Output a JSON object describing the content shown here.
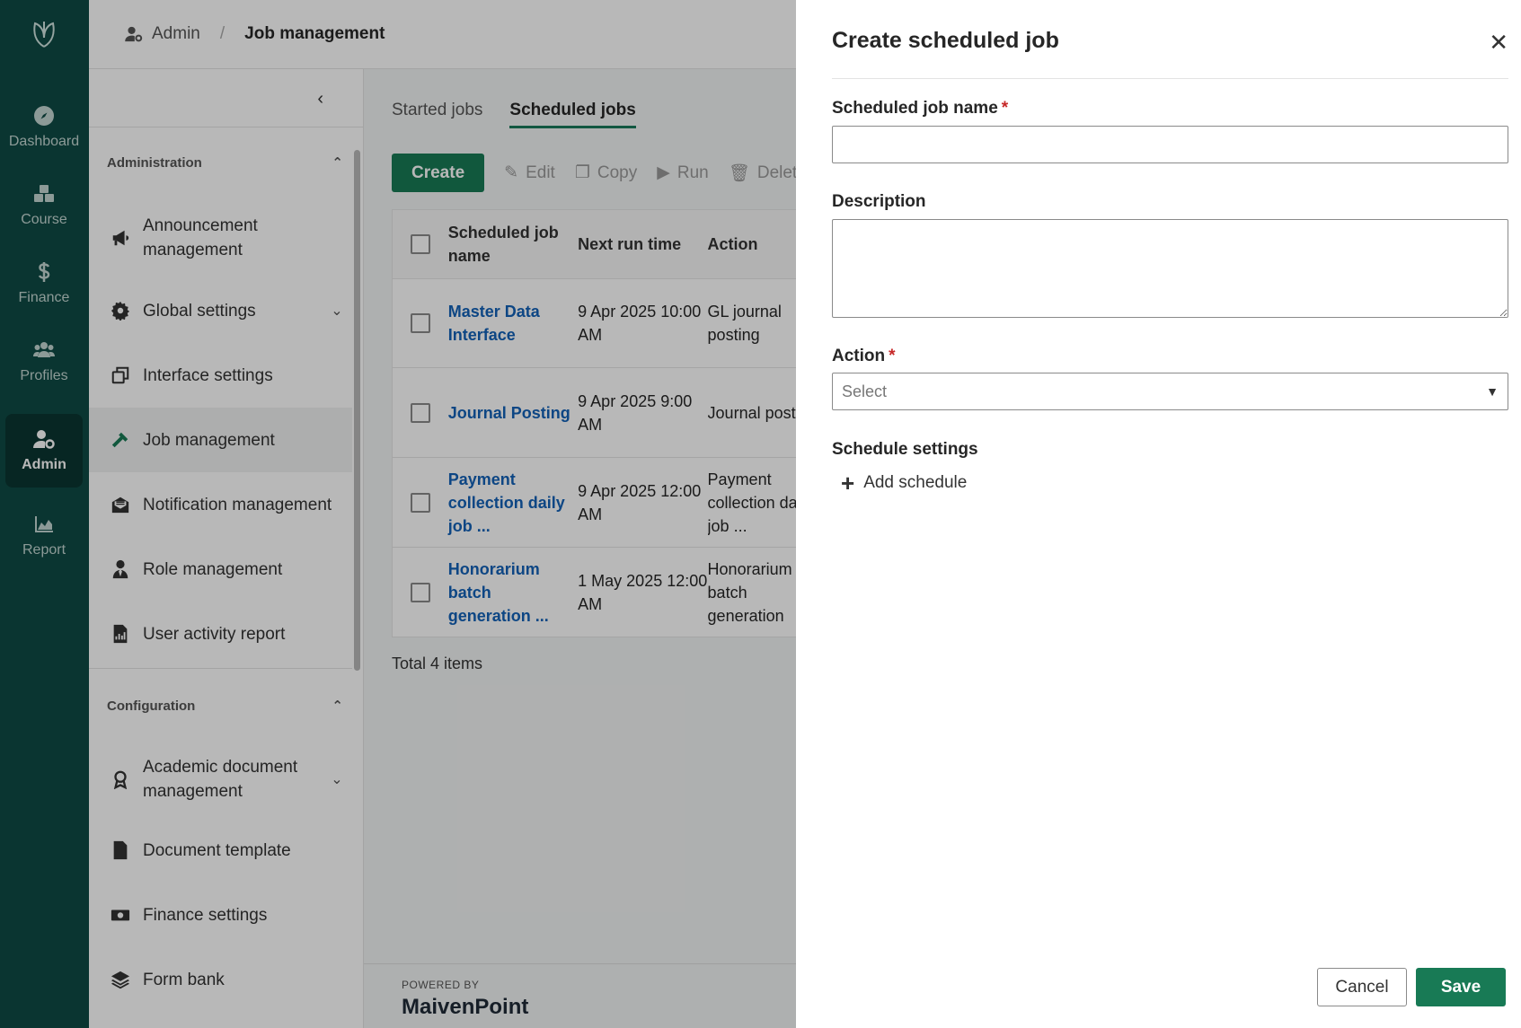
{
  "rail": {
    "items": [
      {
        "label": "Dashboard",
        "icon": "compass-icon"
      },
      {
        "label": "Course",
        "icon": "cubes-icon"
      },
      {
        "label": "Finance",
        "icon": "dollar-icon"
      },
      {
        "label": "Profiles",
        "icon": "users-icon"
      },
      {
        "label": "Admin",
        "icon": "user-gear-icon",
        "active": true
      },
      {
        "label": "Report",
        "icon": "area-chart-icon"
      }
    ]
  },
  "breadcrumb": {
    "parent": "Admin",
    "separator": "/",
    "current": "Job management"
  },
  "sidebar": {
    "sections": [
      {
        "title": "Administration",
        "items": [
          {
            "label": "Announcement management",
            "icon": "megaphone-icon"
          },
          {
            "label": "Global settings",
            "icon": "gear-icon",
            "expandable": true
          },
          {
            "label": "Interface settings",
            "icon": "windows-icon"
          },
          {
            "label": "Job management",
            "icon": "hammer-icon",
            "active": true
          },
          {
            "label": "Notification management",
            "icon": "envelope-icon"
          },
          {
            "label": "Role management",
            "icon": "user-tie-icon"
          },
          {
            "label": "User activity report",
            "icon": "file-chart-icon"
          }
        ]
      },
      {
        "title": "Configuration",
        "items": [
          {
            "label": "Academic document management",
            "icon": "award-icon",
            "expandable": true
          },
          {
            "label": "Document template",
            "icon": "file-icon"
          },
          {
            "label": "Finance settings",
            "icon": "money-icon"
          },
          {
            "label": "Form bank",
            "icon": "layers-icon"
          }
        ]
      }
    ]
  },
  "main": {
    "tabs": [
      {
        "label": "Started jobs"
      },
      {
        "label": "Scheduled jobs",
        "active": true
      }
    ],
    "toolbar": {
      "create": "Create",
      "edit": "Edit",
      "copy": "Copy",
      "run": "Run",
      "delete": "Delet"
    },
    "table": {
      "headers": {
        "name": "Scheduled job name",
        "next_run": "Next run time",
        "action": "Action"
      },
      "rows": [
        {
          "name": "Master Data Interface",
          "next_run": "9 Apr 2025 10:00 AM",
          "action": "GL journal posting"
        },
        {
          "name": "Journal Posting",
          "next_run": "9 Apr 2025 9:00 AM",
          "action": "Journal posting"
        },
        {
          "name": "Payment collection daily job ...",
          "next_run": "9 Apr 2025 12:00 AM",
          "action": "Payment collection daily job ..."
        },
        {
          "name": "Honorarium batch generation ...",
          "next_run": "1 May 2025 12:00 AM",
          "action": "Honorarium batch generation"
        }
      ]
    },
    "total": "Total 4 items"
  },
  "footer": {
    "powered": "POWERED BY",
    "brand": "MaivenPoint"
  },
  "panel": {
    "title": "Create scheduled job",
    "name_label": "Scheduled job name",
    "name_value": "",
    "description_label": "Description",
    "description_value": "",
    "action_label": "Action",
    "action_placeholder": "Select",
    "schedule_label": "Schedule settings",
    "add_schedule": "Add schedule",
    "cancel": "Cancel",
    "save": "Save"
  }
}
